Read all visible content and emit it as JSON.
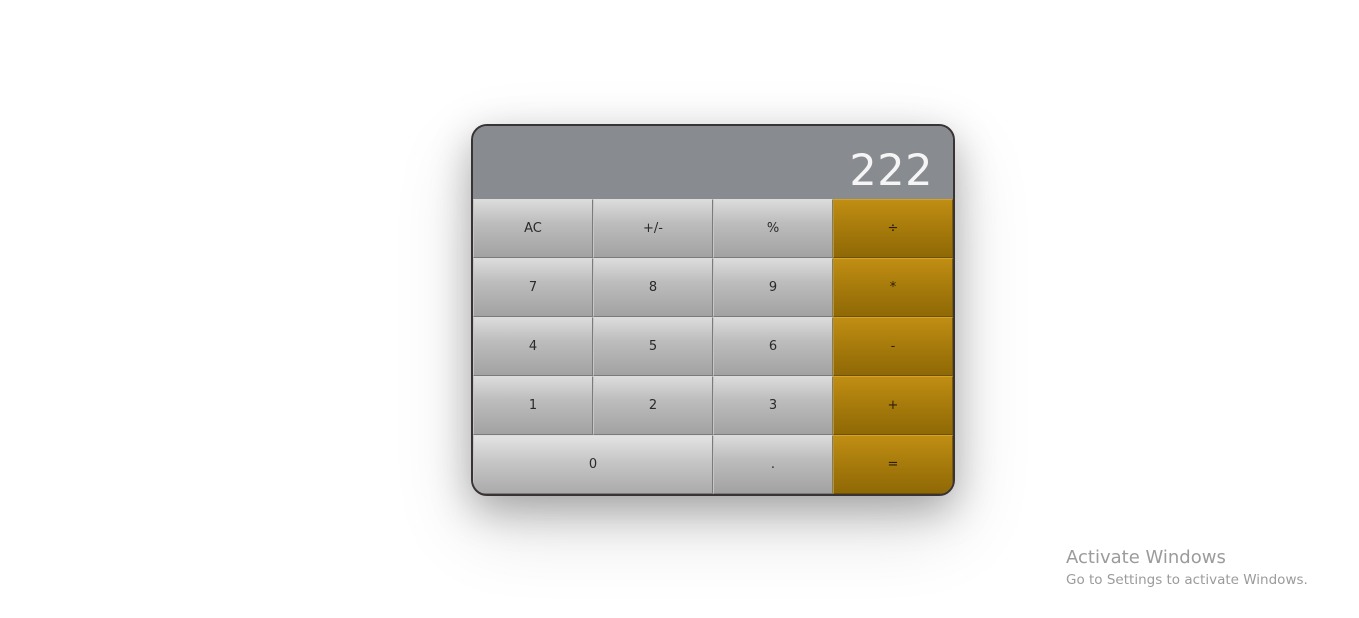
{
  "calculator": {
    "display": "222",
    "keys": {
      "clear": "AC",
      "sign": "+/-",
      "percent": "%",
      "divide": "÷",
      "seven": "7",
      "eight": "8",
      "nine": "9",
      "multiply": "*",
      "four": "4",
      "five": "5",
      "six": "6",
      "subtract": "-",
      "one": "1",
      "two": "2",
      "three": "3",
      "add": "+",
      "zero": "0",
      "decimal": ".",
      "equals": "="
    },
    "colors": {
      "display_bg": "#888b90",
      "operator_key": "#a97c0c",
      "number_key": "#bdbdbd",
      "border": "#3a3333"
    }
  },
  "watermark": {
    "title": "Activate Windows",
    "subtitle": "Go to Settings to activate Windows."
  }
}
